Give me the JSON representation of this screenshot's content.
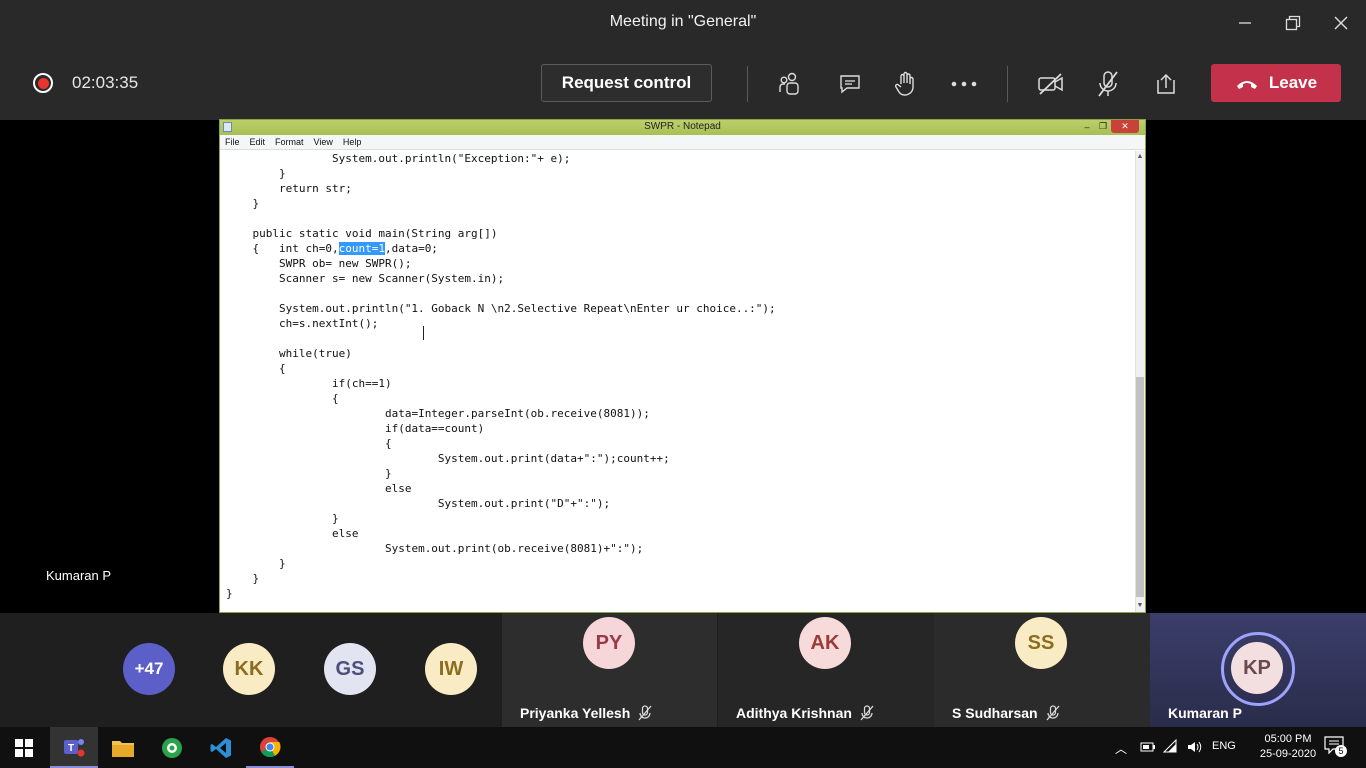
{
  "window": {
    "title": "Meeting in \"General\""
  },
  "toolbar": {
    "timer": "02:03:35",
    "request_control": "Request control",
    "leave": "Leave"
  },
  "notepad": {
    "title": "SWPR - Notepad",
    "menu": [
      "File",
      "Edit",
      "Format",
      "View",
      "Help"
    ],
    "code_before": "\t\tSystem.out.println(\"Exception:\"+ e);\n\t}\n\treturn str;\n    }\n\n    public static void main(String arg[])\n    {\tint ch=0,",
    "code_selected": "count=1",
    "code_after": ",data=0;\n\tSWPR ob= new SWPR();\n\tScanner s= new Scanner(System.in);\n\n\tSystem.out.println(\"1. Goback N \\n2.Selective Repeat\\nEnter ur choice..:\");\n\tch=s.nextInt();\n\n\twhile(true)\n\t{\n\t\tif(ch==1)\n\t\t{\n\t\t\tdata=Integer.parseInt(ob.receive(8081));\n\t\t\tif(data==count)\n\t\t\t{\n\t\t\t\tSystem.out.print(data+\":\");count++;\n\t\t\t}\n\t\t\telse\n\t\t\t\tSystem.out.print(\"D\"+\":\");\n\t\t}\n\t\telse\n\t\t\tSystem.out.print(ob.receive(8081)+\":\");\n\t}\n    }\n}"
  },
  "presenter": {
    "name": "Kumaran P"
  },
  "participants": {
    "overflow": "+47",
    "avatars": [
      {
        "initials": "KK",
        "color": "#f9ecc4",
        "text": "#8a6d1e"
      },
      {
        "initials": "GS",
        "color": "#e3e4f2",
        "text": "#4b4f7a"
      },
      {
        "initials": "IW",
        "color": "#f9ecc4",
        "text": "#8a6d1e"
      }
    ],
    "tiles": [
      {
        "initials": "PY",
        "name": "Priyanka Yellesh",
        "color": "#f6d6d8",
        "text": "#9a3a46"
      },
      {
        "initials": "AK",
        "name": "Adithya Krishnan",
        "color": "#f7dada",
        "text": "#9a3a3a"
      },
      {
        "initials": "SS",
        "name": "S Sudharsan",
        "color": "#f9ecc4",
        "text": "#8a6d1e"
      },
      {
        "initials": "KP",
        "name": "Kumaran P",
        "color": "#f3dfe0",
        "text": "#6a4a4c"
      }
    ]
  },
  "taskbar": {
    "lang": "ENG",
    "time": "05:00 PM",
    "date": "25-09-2020",
    "notifications": "5"
  },
  "colors": {
    "leave": "#c4314b",
    "active_tile": "#7f84cc",
    "record": "#e8342f"
  }
}
